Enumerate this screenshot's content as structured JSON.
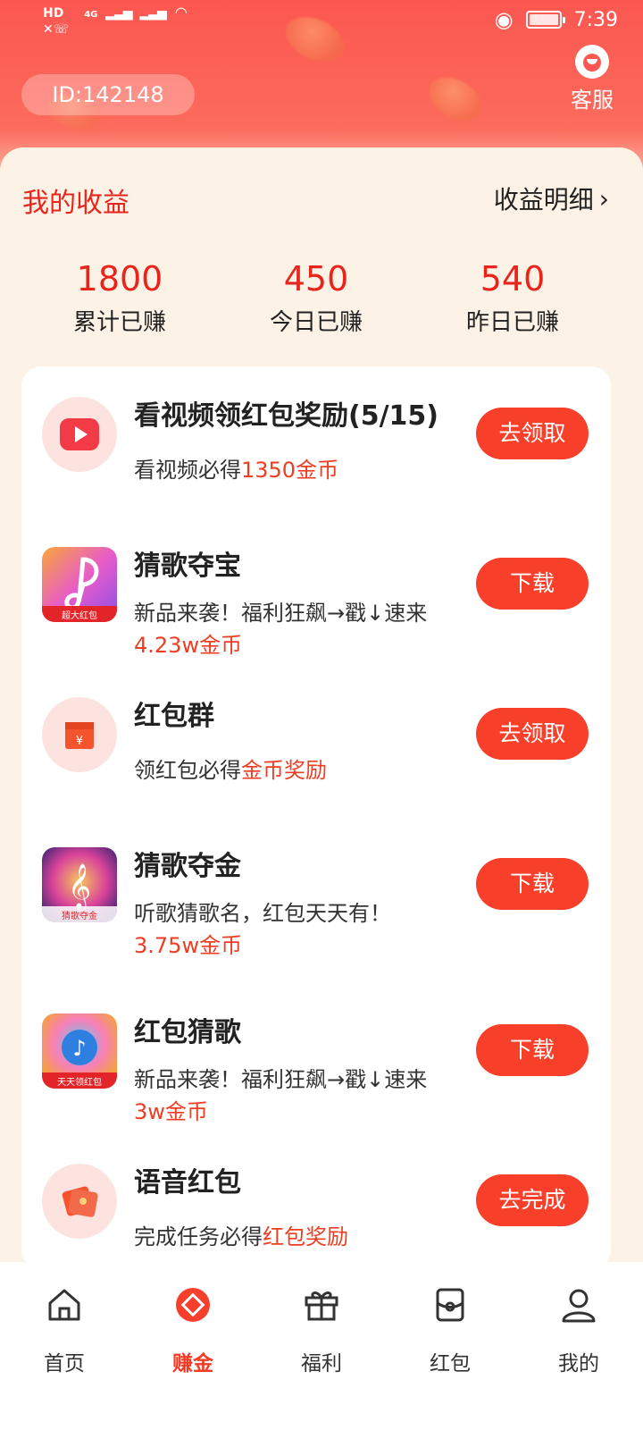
{
  "status_bar": {
    "time": "7:39",
    "network": "4G",
    "hd_label": "HD"
  },
  "header": {
    "user_id": "ID:142148",
    "service_label": "客服"
  },
  "earnings": {
    "title": "我的收益",
    "detail_link": "收益明细",
    "stats": [
      {
        "value": "1800",
        "label": "累计已赚"
      },
      {
        "value": "450",
        "label": "今日已赚"
      },
      {
        "value": "540",
        "label": "昨日已赚"
      }
    ]
  },
  "tasks": [
    {
      "title": "看视频领红包奖励(5/15)",
      "desc": "看视频必得",
      "highlight": "1350金币",
      "reward": "",
      "button": "去领取",
      "icon": "video-play-icon"
    },
    {
      "title": "猜歌夺宝",
      "desc": "新品来袭！福利狂飙→戳↓速来",
      "highlight": "",
      "reward": "4.23w金币",
      "button": "下载",
      "icon": "music-app-icon",
      "badge": "超大红包"
    },
    {
      "title": "红包群",
      "desc": "领红包必得",
      "highlight": "金币奖励",
      "reward": "",
      "button": "去领取",
      "icon": "red-envelope-icon"
    },
    {
      "title": "猜歌夺金",
      "desc": "听歌猜歌名，红包天天有！",
      "highlight": "",
      "reward": "3.75w金币",
      "button": "下载",
      "icon": "music-note-app-icon",
      "badge": "猜歌夺金"
    },
    {
      "title": "红包猜歌",
      "desc": "新品来袭！福利狂飙→戳↓速来",
      "highlight": "",
      "reward": "3w金币",
      "button": "下载",
      "icon": "music-bubble-app-icon",
      "badge": "天天领红包"
    },
    {
      "title": "语音红包",
      "desc": "完成任务必得",
      "highlight": "红包奖励",
      "reward": "",
      "button": "去完成",
      "icon": "voice-envelope-icon"
    }
  ],
  "nav": [
    {
      "label": "首页",
      "icon": "home-icon",
      "active": false
    },
    {
      "label": "赚金",
      "icon": "earn-coin-icon",
      "active": true
    },
    {
      "label": "福利",
      "icon": "gift-icon",
      "active": false
    },
    {
      "label": "红包",
      "icon": "envelope-icon",
      "active": false
    },
    {
      "label": "我的",
      "icon": "profile-icon",
      "active": false
    }
  ],
  "colors": {
    "primary": "#f83f2a",
    "accent_text": "#e8251d",
    "background": "#fdf2e6"
  }
}
